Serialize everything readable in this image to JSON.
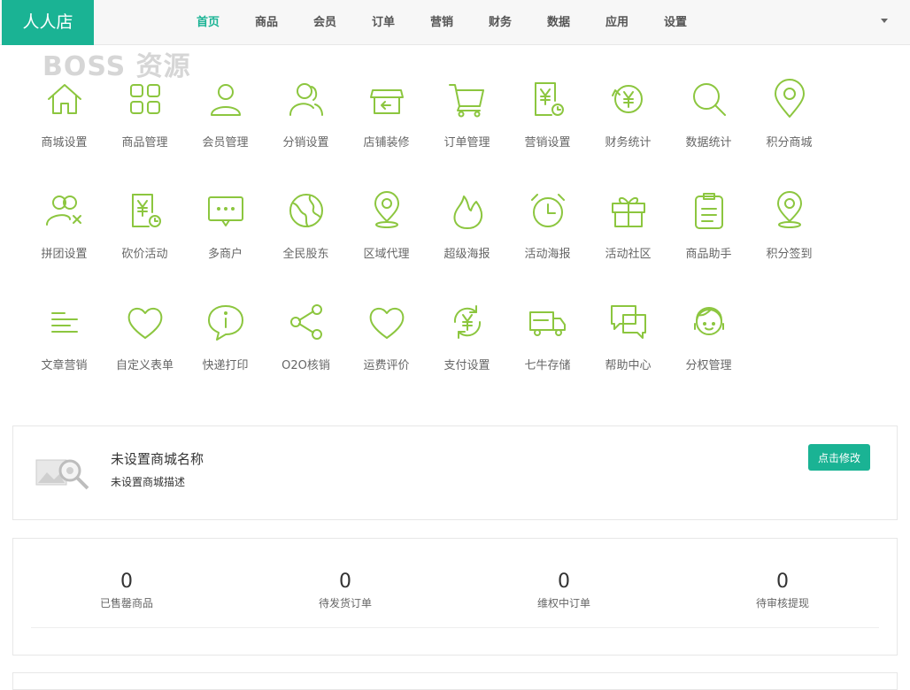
{
  "brand": "人人店",
  "nav": [
    "首页",
    "商品",
    "会员",
    "订单",
    "营销",
    "财务",
    "数据",
    "应用",
    "设置"
  ],
  "active_nav": "首页",
  "watermark": "BOSS 资源",
  "accent_color": "#1ab394",
  "icon_color": "#8cc63f",
  "modules": [
    {
      "label": "商城设置",
      "icon": "home-icon"
    },
    {
      "label": "商品管理",
      "icon": "grid-icon"
    },
    {
      "label": "会员管理",
      "icon": "user-icon"
    },
    {
      "label": "分销设置",
      "icon": "users-icon"
    },
    {
      "label": "店铺装修",
      "icon": "store-icon"
    },
    {
      "label": "订单管理",
      "icon": "cart-icon"
    },
    {
      "label": "营销设置",
      "icon": "yen-receipt-icon"
    },
    {
      "label": "财务统计",
      "icon": "yen-refresh-icon"
    },
    {
      "label": "数据统计",
      "icon": "search-icon"
    },
    {
      "label": "积分商城",
      "icon": "location-pin-icon"
    },
    {
      "label": "拼团设置",
      "icon": "group-icon"
    },
    {
      "label": "砍价活动",
      "icon": "yen-clock-icon"
    },
    {
      "label": "多商户",
      "icon": "chat-icon"
    },
    {
      "label": "全民股东",
      "icon": "globe-icon"
    },
    {
      "label": "区域代理",
      "icon": "map-pin-icon"
    },
    {
      "label": "超级海报",
      "icon": "flame-icon"
    },
    {
      "label": "活动海报",
      "icon": "alarm-clock-icon"
    },
    {
      "label": "活动社区",
      "icon": "gift-icon"
    },
    {
      "label": "商品助手",
      "icon": "clipboard-icon"
    },
    {
      "label": "积分签到",
      "icon": "map-pin-icon"
    },
    {
      "label": "文章营销",
      "icon": "text-lines-icon"
    },
    {
      "label": "自定义表单",
      "icon": "heart-icon"
    },
    {
      "label": "快递打印",
      "icon": "info-bubble-icon"
    },
    {
      "label": "O2O核销",
      "icon": "share-icon"
    },
    {
      "label": "运费评价",
      "icon": "heart-outline-icon"
    },
    {
      "label": "支付设置",
      "icon": "yen-cycle-icon"
    },
    {
      "label": "七牛存储",
      "icon": "truck-icon"
    },
    {
      "label": "帮助中心",
      "icon": "chat-bubbles-icon"
    },
    {
      "label": "分权管理",
      "icon": "support-agent-icon"
    }
  ],
  "shop": {
    "name": "未设置商城名称",
    "description": "未设置商城描述",
    "edit_label": "点击修改"
  },
  "stats": [
    {
      "value": "0",
      "label": "已售罄商品"
    },
    {
      "value": "0",
      "label": "待发货订单"
    },
    {
      "value": "0",
      "label": "维权中订单"
    },
    {
      "value": "0",
      "label": "待审核提现"
    }
  ]
}
